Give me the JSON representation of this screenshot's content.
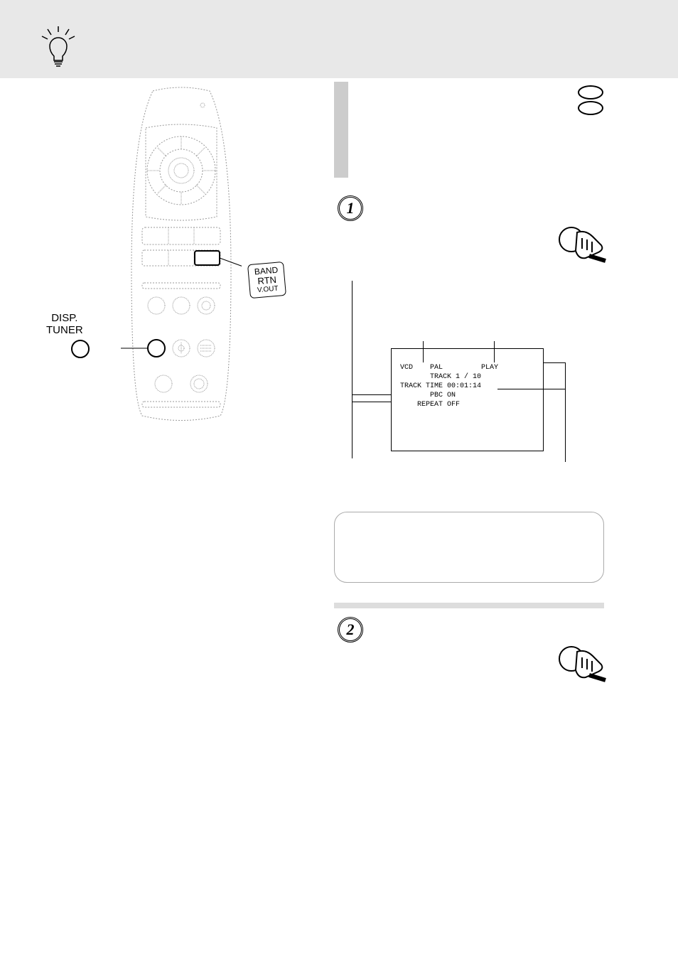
{
  "remote_buttons": {
    "disp_tuner_line1": "DISP.",
    "disp_tuner_line2": "TUNER",
    "band_line1": "BAND",
    "band_line2": "RTN",
    "band_line3": "V.OUT"
  },
  "steps": {
    "one": "1",
    "two": "2"
  },
  "osd": {
    "line1": "VCD    PAL         PLAY",
    "line2": "       TRACK 1 / 10",
    "line3": "",
    "line4": "TRACK TIME 00:01:14",
    "line5": "       PBC ON",
    "line6": "    REPEAT OFF"
  }
}
